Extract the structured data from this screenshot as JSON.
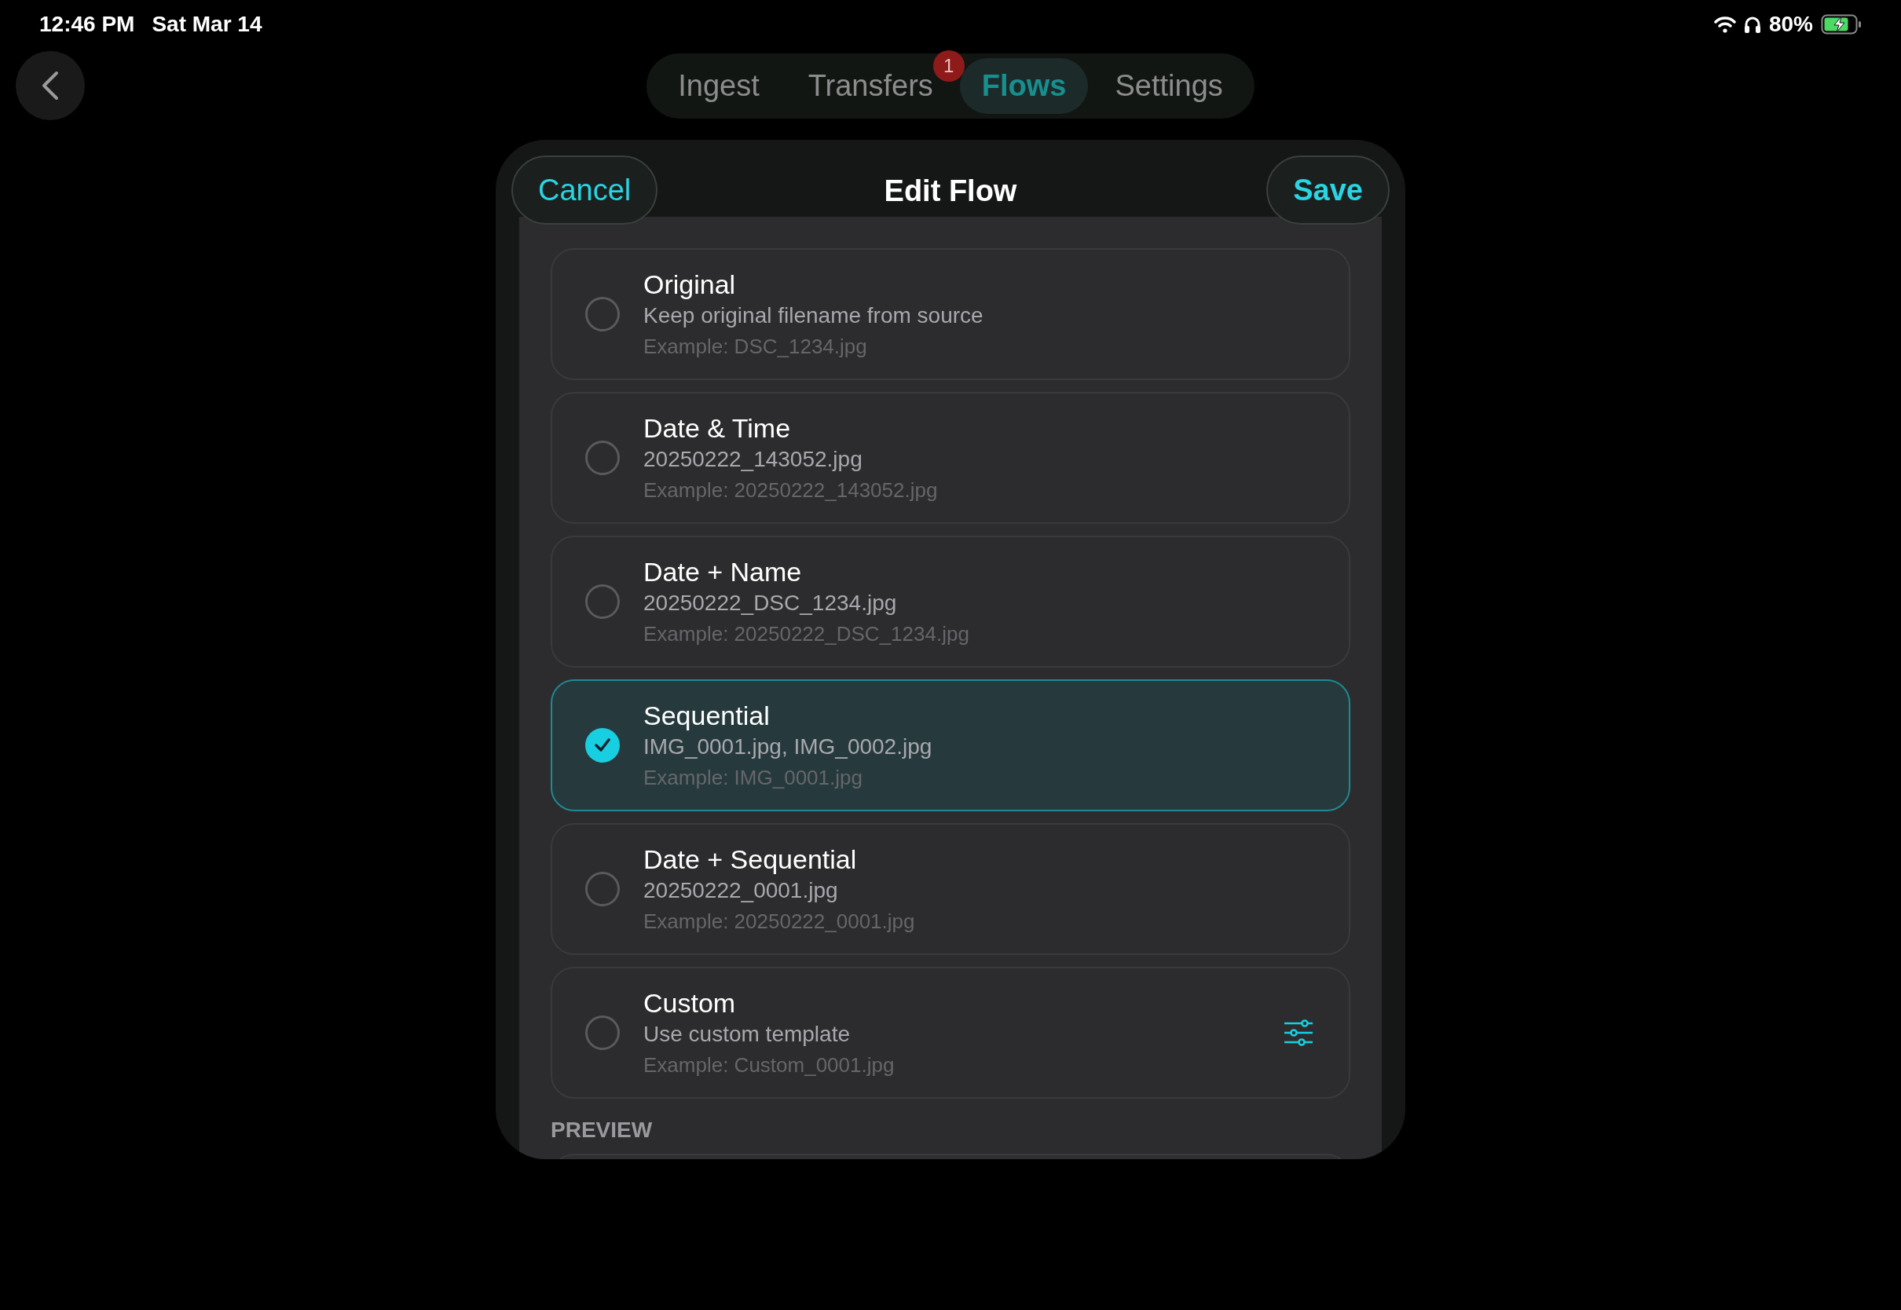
{
  "status_bar": {
    "time": "12:46 PM",
    "date": "Sat Mar 14",
    "battery": "80%"
  },
  "tabs": [
    {
      "label": "Ingest",
      "selected": false
    },
    {
      "label": "Transfers",
      "selected": false,
      "badge": "1"
    },
    {
      "label": "Flows",
      "selected": true
    },
    {
      "label": "Settings",
      "selected": false
    }
  ],
  "sheet": {
    "title": "Edit Flow",
    "cancel": "Cancel",
    "save": "Save",
    "options": [
      {
        "title": "Original",
        "description": "Keep original filename from source",
        "example": "Example: DSC_1234.jpg",
        "selected": false
      },
      {
        "title": "Date & Time",
        "description": "20250222_143052.jpg",
        "example": "Example: 20250222_143052.jpg",
        "selected": false
      },
      {
        "title": "Date + Name",
        "description": "20250222_DSC_1234.jpg",
        "example": "Example: 20250222_DSC_1234.jpg",
        "selected": false
      },
      {
        "title": "Sequential",
        "description": "IMG_0001.jpg, IMG_0002.jpg",
        "example": "Example: IMG_0001.jpg",
        "selected": true
      },
      {
        "title": "Date + Sequential",
        "description": "20250222_0001.jpg",
        "example": "Example: 20250222_0001.jpg",
        "selected": false
      },
      {
        "title": "Custom",
        "description": "Use custom template",
        "example": "Example: Custom_0001.jpg",
        "selected": false,
        "kind": "configurable"
      }
    ],
    "preview_heading": "PREVIEW"
  }
}
